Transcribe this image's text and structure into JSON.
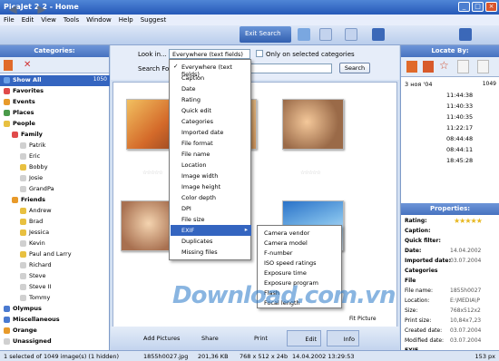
{
  "title": "PicaJet 2.2 - Home",
  "menu": [
    "File",
    "Edit",
    "View",
    "Tools",
    "Window",
    "Help",
    "Suggest"
  ],
  "toolbar": {
    "exit_search": "Exit Search"
  },
  "categories": {
    "header": "Categories:",
    "items": [
      {
        "label": "Show All",
        "count": "1050",
        "indent": 0,
        "selected": true,
        "color": "#6aa0e8"
      },
      {
        "label": "Favorites",
        "count": "",
        "indent": 0,
        "color": "#e04a4a"
      },
      {
        "label": "Events",
        "count": "",
        "indent": 0,
        "color": "#e89a2a"
      },
      {
        "label": "Places",
        "count": "",
        "indent": 0,
        "color": "#4a9a4a"
      },
      {
        "label": "People",
        "count": "",
        "indent": 0,
        "color": "#e8c040"
      },
      {
        "label": "Family",
        "count": "",
        "indent": 1,
        "color": "#e04a4a"
      },
      {
        "label": "Patrik",
        "count": "",
        "indent": 2,
        "color": "#d0d0d0"
      },
      {
        "label": "Eric",
        "count": "",
        "indent": 2,
        "color": "#d0d0d0"
      },
      {
        "label": "Bobby",
        "count": "",
        "indent": 2,
        "color": "#e8c040"
      },
      {
        "label": "Josie",
        "count": "",
        "indent": 2,
        "color": "#d0d0d0"
      },
      {
        "label": "GrandPa",
        "count": "",
        "indent": 2,
        "color": "#d0d0d0"
      },
      {
        "label": "Friends",
        "count": "",
        "indent": 1,
        "color": "#e89a2a"
      },
      {
        "label": "Andrew",
        "count": "",
        "indent": 2,
        "color": "#e8c040"
      },
      {
        "label": "Brad",
        "count": "",
        "indent": 2,
        "color": "#e8c040"
      },
      {
        "label": "Jessica",
        "count": "",
        "indent": 2,
        "color": "#e8c040"
      },
      {
        "label": "Kevin",
        "count": "",
        "indent": 2,
        "color": "#d0d0d0"
      },
      {
        "label": "Paul and Larry",
        "count": "",
        "indent": 2,
        "color": "#e8c040"
      },
      {
        "label": "Richard",
        "count": "",
        "indent": 2,
        "color": "#d0d0d0"
      },
      {
        "label": "Steve",
        "count": "",
        "indent": 2,
        "color": "#d0d0d0"
      },
      {
        "label": "Steve II",
        "count": "",
        "indent": 2,
        "color": "#d0d0d0"
      },
      {
        "label": "Tommy",
        "count": "",
        "indent": 2,
        "color": "#d0d0d0"
      },
      {
        "label": "Olympus",
        "count": "",
        "indent": 0,
        "color": "#4a7ad0"
      },
      {
        "label": "Miscellaneous",
        "count": "",
        "indent": 0,
        "color": "#4a7ad0"
      },
      {
        "label": "Orange",
        "count": "",
        "indent": 0,
        "color": "#e89a2a"
      },
      {
        "label": "Unassigned",
        "count": "",
        "indent": 0,
        "color": "#d0d0d0"
      }
    ]
  },
  "search": {
    "look_in_label": "Look in...",
    "look_in_value": "Everywhere (text fields)",
    "only_selected": "Only on selected categories",
    "search_for_label": "Search For",
    "search_button": "Search"
  },
  "lookin_menu": [
    {
      "label": "Everywhere (text fields)",
      "checked": true
    },
    {
      "label": "Caption"
    },
    {
      "label": "Date"
    },
    {
      "label": "Rating"
    },
    {
      "label": "Quick edit"
    },
    {
      "label": "Categories"
    },
    {
      "label": "Imported date"
    },
    {
      "label": "File format"
    },
    {
      "label": "File name"
    },
    {
      "label": "Location"
    },
    {
      "label": "Image width"
    },
    {
      "label": "Image height"
    },
    {
      "label": "Color depth"
    },
    {
      "label": "DPI"
    },
    {
      "label": "File size"
    },
    {
      "label": "EXIF",
      "highlight": true
    },
    {
      "label": "Duplicates"
    },
    {
      "label": "Missing files"
    }
  ],
  "exif_menu": [
    "Camera vendor",
    "Camera model",
    "F-number",
    "ISO speed ratings",
    "Exposure time",
    "Exposure program",
    "Flash",
    "Focal length"
  ],
  "locate": {
    "header": "Locate By:",
    "date_label": "3 нoя '04",
    "date_count": "1049",
    "times": [
      "11:44:38",
      "11:40:33",
      "11:40:35",
      "11:22:17",
      "08:44:48",
      "08:44:11",
      "18:45:28"
    ]
  },
  "properties": {
    "header": "Properties:",
    "rows": [
      {
        "label": "Rating:",
        "value": ""
      },
      {
        "label": "Caption:",
        "value": ""
      },
      {
        "label": "Quick filter:",
        "value": ""
      },
      {
        "label": "Date:",
        "value": "14.04.2002"
      },
      {
        "label": "Imported date:",
        "value": "03.07.2004"
      }
    ],
    "section_categories": "Categories",
    "section_file": "File",
    "file_rows": [
      {
        "label": "File name:",
        "value": "1855h0027"
      },
      {
        "label": "Location:",
        "value": "E:\\MEDIA\\P"
      },
      {
        "label": "Size:",
        "value": "768x512x2"
      },
      {
        "label": "Print size:",
        "value": "10,84x7,23"
      },
      {
        "label": "Created date:",
        "value": "03.07.2004"
      },
      {
        "label": "Modified date:",
        "value": "03.07.2004"
      }
    ],
    "section_exif": "EXIF"
  },
  "bottom": {
    "add": "Add Pictures",
    "share": "Share",
    "print": "Print",
    "edit": "Edit",
    "info": "Info",
    "fit": "Fit Picture"
  },
  "status": {
    "selection": "1 selected of 1049 image(s) (1 hidden)",
    "file": "1855h0027.jpg",
    "size": "201,36 KB",
    "dims": "768 x 512 x 24b",
    "date": "14.04.2002 13:29:53",
    "zoom": "153 px"
  },
  "watermark": "Download.com.vn"
}
